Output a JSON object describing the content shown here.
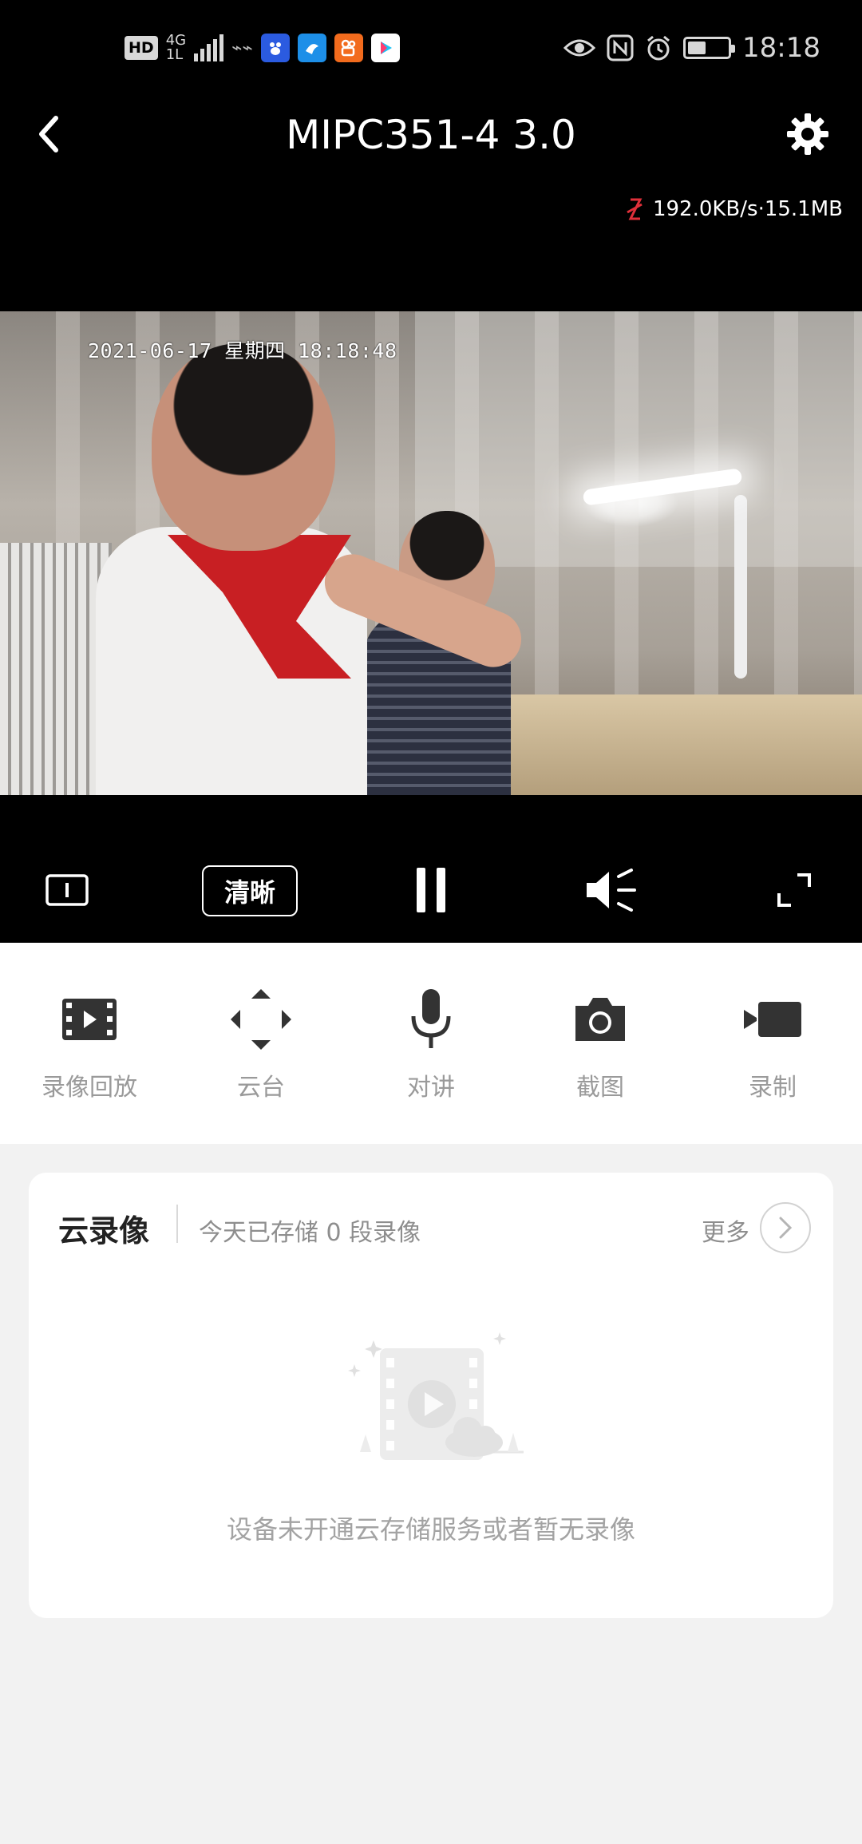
{
  "status_bar": {
    "hd": "HD",
    "net_top": "4G",
    "net_bottom": "1L",
    "time": "18:18",
    "battery_level": 0.45,
    "apps": [
      {
        "name": "baidu-app-icon",
        "color": "#2b5be0"
      },
      {
        "name": "fox-app-icon",
        "color": "#1d8fe8"
      },
      {
        "name": "kuaishou-app-icon",
        "color": "#f26b1d"
      },
      {
        "name": "youku-app-icon",
        "color": "#ffffff"
      }
    ]
  },
  "header": {
    "title": "MIPC351-4 3.0",
    "rate": "192.0KB/s·15.1MB"
  },
  "video": {
    "timestamp": "2021-06-17 星期四 18:18:48"
  },
  "player_controls": {
    "quality_label": "清晰"
  },
  "actions": [
    {
      "label": "录像回放",
      "icon": "film-icon"
    },
    {
      "label": "云台",
      "icon": "direction-arrows-icon"
    },
    {
      "label": "对讲",
      "icon": "microphone-icon"
    },
    {
      "label": "截图",
      "icon": "camera-icon"
    },
    {
      "label": "录制",
      "icon": "video-record-icon"
    }
  ],
  "cloud_card": {
    "title": "云录像",
    "subtitle": "今天已存储 0 段录像",
    "more_label": "更多",
    "empty_text": "设备未开通云存储服务或者暂无录像"
  },
  "colors": {
    "top_background": "#000000",
    "page_background": "#f2f2f2",
    "icon_dark": "#333333",
    "label_gray": "#9a9a9a",
    "rate_icon": "#e0303a"
  }
}
